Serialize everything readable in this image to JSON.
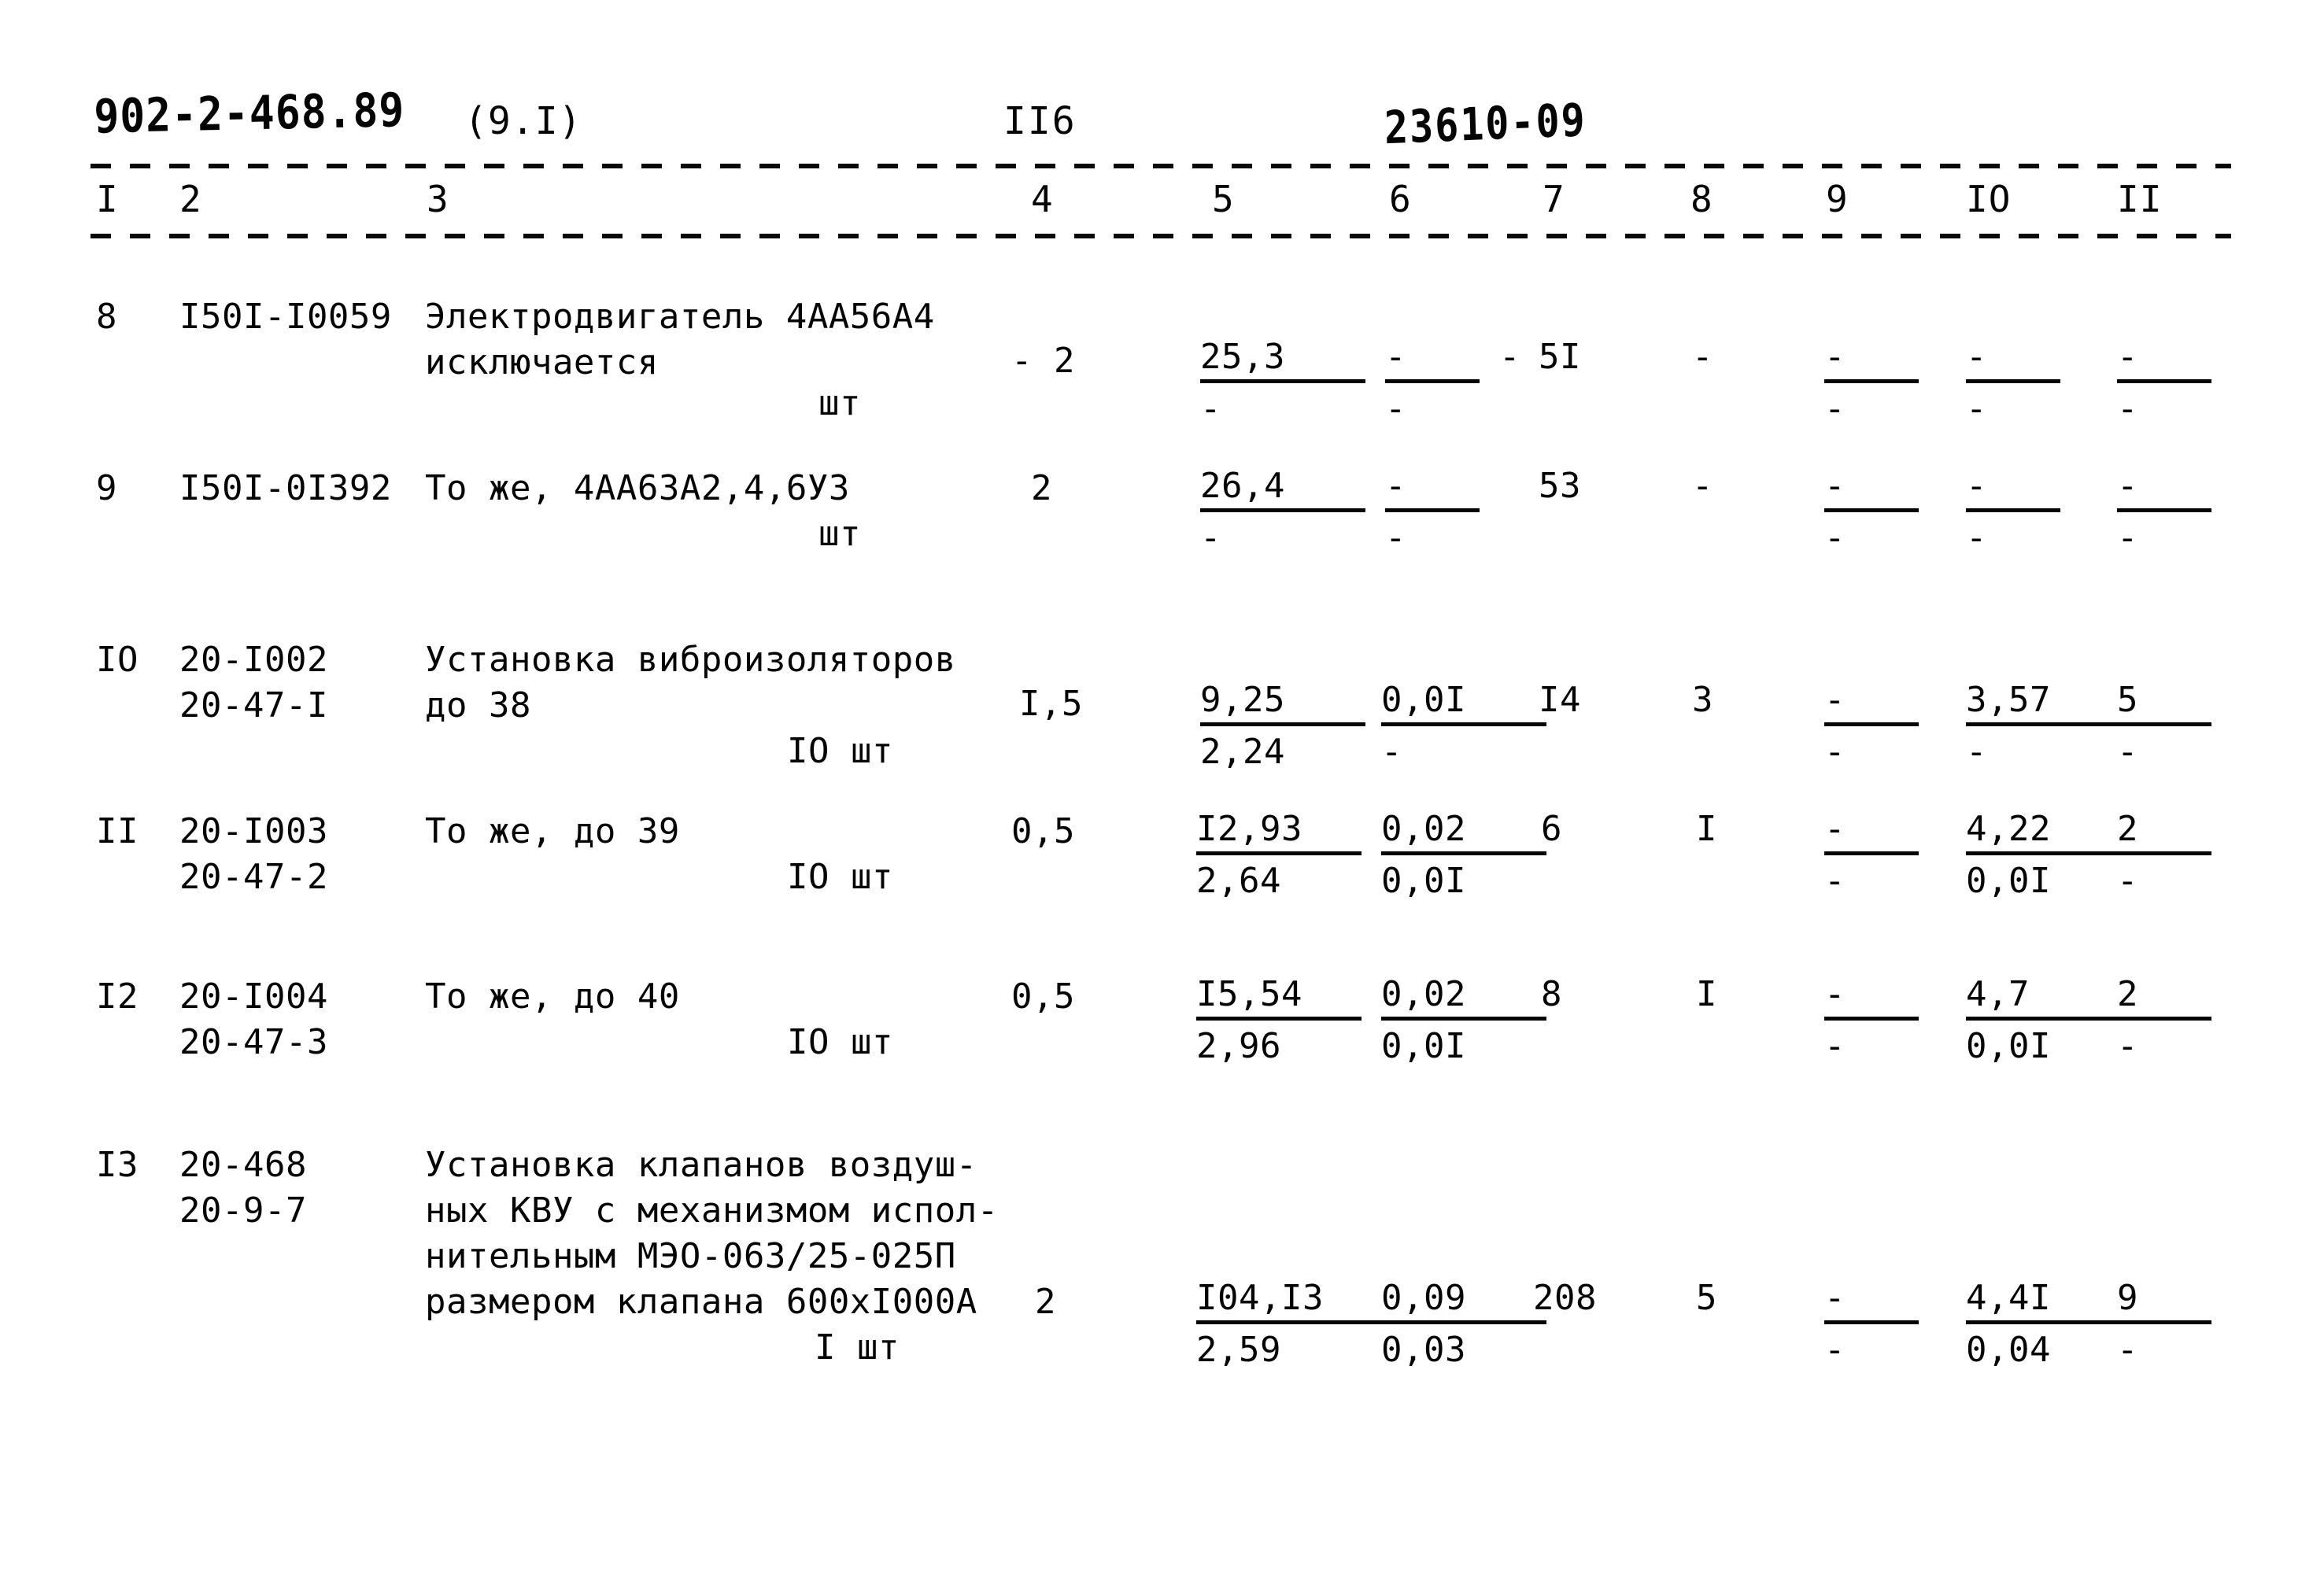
{
  "header": {
    "doc_code": "902-2-468.89",
    "section": "(9.I)",
    "page_number": "II6",
    "stamp_code": "23610-09"
  },
  "table": {
    "column_headers": [
      "I",
      "2",
      "3",
      "4",
      "5",
      "6",
      "7",
      "8",
      "9",
      "IO",
      "II"
    ],
    "rows": [
      {
        "c1": "8",
        "c2": "I50I-I0059",
        "c3_lines": "Электродвигатель 4АА56А4\nисключается",
        "c3_unit": "шт",
        "c4": "- 2",
        "c5_top": "25,3",
        "c5_bot": "-",
        "c6_top": "-",
        "c6_bot": "-",
        "c6_extra": "-",
        "c7": "5I",
        "c8": "-",
        "c9_top": "-",
        "c9_bot": "-",
        "c10_top": "-",
        "c10_bot": "-",
        "c11_top": "-",
        "c11_bot": "-"
      },
      {
        "c1": "9",
        "c2": "I50I-0I392",
        "c3_lines": "То же, 4АА63А2,4,6У3",
        "c3_unit": "шт",
        "c4": "2",
        "c5_top": "26,4",
        "c5_bot": "-",
        "c6_top": "-",
        "c6_bot": "-",
        "c6_extra": "",
        "c7": "53",
        "c8": "-",
        "c9_top": "-",
        "c9_bot": "-",
        "c10_top": "-",
        "c10_bot": "-",
        "c11_top": "-",
        "c11_bot": "-"
      },
      {
        "c1": "IO",
        "c2": "20-I002\n20-47-I",
        "c3_lines": "Установка виброизоляторов\nдо 38",
        "c3_unit": "IO шт",
        "c4": "I,5",
        "c5_top": "9,25",
        "c5_bot": "2,24",
        "c6_top": "0,0I",
        "c6_bot": "-",
        "c6_extra": "",
        "c7": "I4",
        "c8": "3",
        "c9_top": "-",
        "c9_bot": "-",
        "c10_top": "3,57",
        "c10_bot": "-",
        "c11_top": "5",
        "c11_bot": "-"
      },
      {
        "c1": "II",
        "c2": "20-I003\n20-47-2",
        "c3_lines": "То же, до 39",
        "c3_unit": "IO шт",
        "c4": "0,5",
        "c5_top": "I2,93",
        "c5_bot": "2,64",
        "c6_top": "0,02",
        "c6_bot": "0,0I",
        "c6_extra": "",
        "c7": "6",
        "c8": "I",
        "c9_top": "-",
        "c9_bot": "-",
        "c10_top": "4,22",
        "c10_bot": "0,0I",
        "c11_top": "2",
        "c11_bot": "-"
      },
      {
        "c1": "I2",
        "c2": "20-I004\n20-47-3",
        "c3_lines": "То же, до 40",
        "c3_unit": "IO шт",
        "c4": "0,5",
        "c5_top": "I5,54",
        "c5_bot": "2,96",
        "c6_top": "0,02",
        "c6_bot": "0,0I",
        "c6_extra": "",
        "c7": "8",
        "c8": "I",
        "c9_top": "-",
        "c9_bot": "-",
        "c10_top": "4,7",
        "c10_bot": "0,0I",
        "c11_top": "2",
        "c11_bot": "-"
      },
      {
        "c1": "I3",
        "c2": "20-468\n20-9-7",
        "c3_lines": "Установка клапанов воздуш-\nных КВУ с механизмом испол-\nнительным МЭО-063/25-025П\nразмером клапана 600хI000А",
        "c3_unit": "I шт",
        "c4": "2",
        "c5_top": "I04,I3",
        "c5_bot": "2,59",
        "c6_top": "0,09",
        "c6_bot": "0,03",
        "c6_extra": "",
        "c7": "208",
        "c8": "5",
        "c9_top": "-",
        "c9_bot": "-",
        "c10_top": "4,4I",
        "c10_bot": "0,04",
        "c11_top": "9",
        "c11_bot": "-"
      }
    ]
  }
}
